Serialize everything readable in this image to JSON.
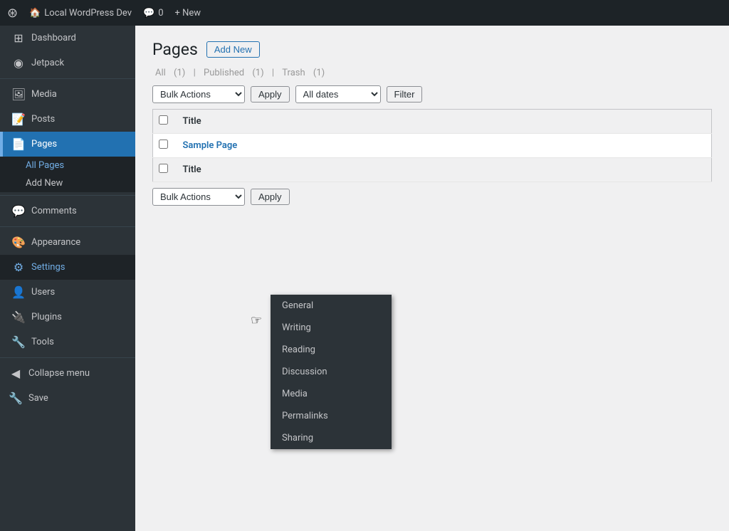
{
  "adminBar": {
    "logo": "⊞",
    "siteName": "Local WordPress Dev",
    "commentsIcon": "💬",
    "commentsCount": "0",
    "newLabel": "+ New"
  },
  "sidebar": {
    "items": [
      {
        "id": "dashboard",
        "icon": "⊞",
        "label": "Dashboard"
      },
      {
        "id": "jetpack",
        "icon": "◉",
        "label": "Jetpack"
      },
      {
        "id": "media",
        "icon": "🖼",
        "label": "Media"
      },
      {
        "id": "posts",
        "icon": "📝",
        "label": "Posts"
      },
      {
        "id": "pages",
        "icon": "📄",
        "label": "Pages",
        "active": true
      },
      {
        "id": "comments",
        "icon": "💬",
        "label": "Comments"
      },
      {
        "id": "appearance",
        "icon": "🎨",
        "label": "Appearance"
      },
      {
        "id": "settings",
        "icon": "⚙",
        "label": "Settings",
        "current": true
      },
      {
        "id": "users",
        "icon": "👤",
        "label": "Users"
      },
      {
        "id": "plugins",
        "icon": "🔌",
        "label": "Plugins"
      },
      {
        "id": "tools",
        "icon": "🔧",
        "label": "Tools"
      }
    ],
    "pagesSubItems": [
      {
        "id": "all-pages",
        "label": "All Pages",
        "active": true
      },
      {
        "id": "add-new",
        "label": "Add New"
      }
    ],
    "collapseLabel": "Collapse menu",
    "saveLabel": "Save"
  },
  "content": {
    "pageTitle": "Pages",
    "addNewLabel": "Add New",
    "filterLinks": {
      "all": "All",
      "allCount": "(1)",
      "published": "Published",
      "publishedCount": "(1)",
      "trash": "Trash",
      "trashCount": "(1)"
    },
    "topNav": {
      "bulkActionsLabel": "Bulk Actions",
      "applyLabel": "Apply",
      "allDatesLabel": "All dates",
      "filterLabel": "Filter"
    },
    "table": {
      "titleHeader": "Title",
      "rows": [
        {
          "id": "sample-page",
          "title": "Sample Page"
        }
      ]
    },
    "bottomNav": {
      "bulkActionsLabel": "Bulk Actions",
      "applyLabel": "Apply"
    }
  },
  "settingsFlyout": {
    "items": [
      {
        "id": "general",
        "label": "General"
      },
      {
        "id": "writing",
        "label": "Writing"
      },
      {
        "id": "reading",
        "label": "Reading"
      },
      {
        "id": "discussion",
        "label": "Discussion"
      },
      {
        "id": "media",
        "label": "Media"
      },
      {
        "id": "permalinks",
        "label": "Permalinks"
      },
      {
        "id": "sharing",
        "label": "Sharing"
      }
    ]
  }
}
